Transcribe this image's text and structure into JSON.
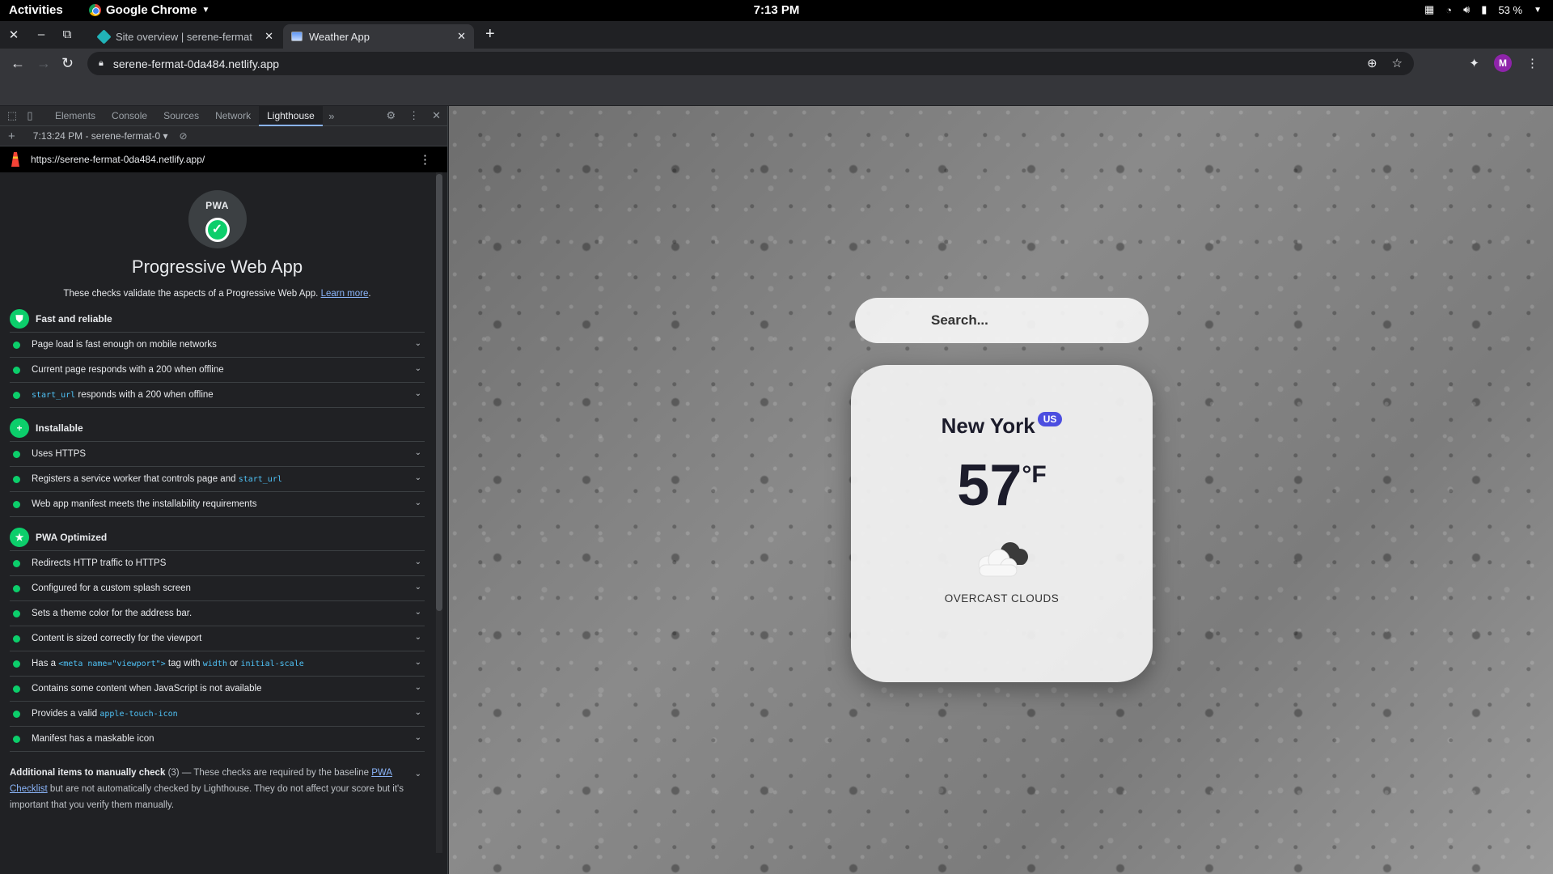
{
  "os": {
    "activities": "Activities",
    "app_name": "Google Chrome",
    "clock": "7:13 PM",
    "battery": "53 %"
  },
  "browser": {
    "tabs": [
      {
        "title": "Site overview | serene-fermat",
        "active": false
      },
      {
        "title": "Weather App",
        "active": true
      }
    ],
    "url": "serene-fermat-0da484.netlify.app",
    "profile_initial": "M"
  },
  "devtools": {
    "tabs": [
      "Elements",
      "Console",
      "Sources",
      "Network",
      "Lighthouse"
    ],
    "active_tab": "Lighthouse",
    "report_label": "7:13:24 PM - serene-fermat-0",
    "report_url": "https://serene-fermat-0da484.netlify.app/",
    "category_badge": "PWA",
    "category_title": "Progressive Web App",
    "category_description": "These checks validate the aspects of a Progressive Web App.",
    "learn_more": "Learn more",
    "groups": [
      {
        "title": "Fast and reliable",
        "audits": [
          {
            "text": "Page load is fast enough on mobile networks"
          },
          {
            "text": "Current page responds with a 200 when offline"
          },
          {
            "code": "start_url",
            "text": " responds with a 200 when offline"
          }
        ]
      },
      {
        "title": "Installable",
        "audits": [
          {
            "text": "Uses HTTPS"
          },
          {
            "text": "Registers a service worker that controls page and ",
            "code": "start_url"
          },
          {
            "text": "Web app manifest meets the installability requirements"
          }
        ]
      },
      {
        "title": "PWA Optimized",
        "audits": [
          {
            "text": "Redirects HTTP traffic to HTTPS"
          },
          {
            "text": "Configured for a custom splash screen"
          },
          {
            "text": "Sets a theme color for the address bar."
          },
          {
            "text": "Content is sized correctly for the viewport"
          },
          {
            "text": "Has a ",
            "code": "<meta name=\"viewport\">",
            "text2": " tag with ",
            "code2": "width",
            "text3": " or ",
            "code3": "initial-scale"
          },
          {
            "text": "Contains some content when JavaScript is not available"
          },
          {
            "text": "Provides a valid ",
            "code": "apple-touch-icon"
          },
          {
            "text": "Manifest has a maskable icon"
          }
        ]
      }
    ],
    "manual": {
      "title": "Additional items to manually check",
      "count": "(3)",
      "text_before": " — These checks are required by the baseline ",
      "link": "PWA Checklist",
      "text_after": " but are not automatically checked by Lighthouse. They do not affect your score but it's important that you verify them manually."
    }
  },
  "weather_app": {
    "search_placeholder": "Search...",
    "city": "New York",
    "country": "US",
    "temperature": "57",
    "unit": "°F",
    "description": "OVERCAST CLOUDS",
    "icon": "overcast-clouds-icon"
  }
}
